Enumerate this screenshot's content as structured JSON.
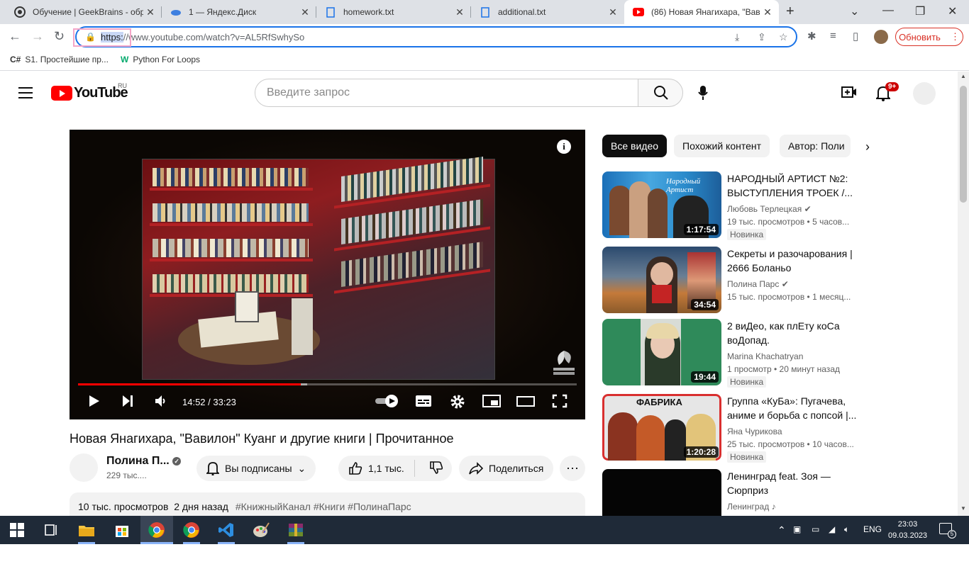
{
  "browser": {
    "tabs": [
      {
        "title": "Обучение | GeekBrains - обр",
        "icon": "geekbrains-icon"
      },
      {
        "title": "1 — Яндекс.Диск",
        "icon": "yandex-disk-icon"
      },
      {
        "title": "homework.txt",
        "icon": "document-icon"
      },
      {
        "title": "additional.txt",
        "icon": "document-icon"
      },
      {
        "title": "(86) Новая Янагихара, \"Вави",
        "icon": "youtube-icon"
      }
    ],
    "url_scheme": "https:",
    "url_rest": "//www.youtube.com/watch?v=AL5RfSwhySo",
    "update_label": "Обновить",
    "bookmarks": [
      "S1. Простейшие пр...",
      "Python For Loops"
    ]
  },
  "youtube": {
    "logo_text": "YouTube",
    "region": "RU",
    "search_placeholder": "Введите запрос",
    "notif_badge": "9+",
    "player": {
      "time": "14:52 / 33:23",
      "progress": 0.446
    },
    "video_title": "Новая Янагихара, \"Вавилон\" Куанг и другие книги | Прочитанное",
    "channel_name": "Полина П...",
    "subscribers": "229 тыс....",
    "subscribed_label": "Вы подписаны",
    "likes": "1,1 тыс.",
    "share_label": "Поделиться",
    "views": "10 тыс. просмотров",
    "date": "2 дня назад",
    "tags": "#КнижныйКанал #Книги #ПолинаПарс",
    "chips": [
      "Все видео",
      "Похожий контент",
      "Автор: Поли"
    ],
    "recommendations": [
      {
        "title": "НАРОДНЫЙ АРТИСТ №2: ВЫСТУПЛЕНИЯ ТРОЕК /...",
        "channel": "Любовь Терлецкая",
        "meta": "19 тыс. просмотров • 5 часов...",
        "duration": "1:17:54",
        "badge": "Новинка"
      },
      {
        "title": "Секреты и разочарования | 2666 Боланьо",
        "channel": "Полина Парс",
        "meta": "15 тыс. просмотров • 1 месяц...",
        "duration": "34:54",
        "badge": ""
      },
      {
        "title": "2 виДео, как плЕту коСа воДопад.",
        "channel": "Marina Khachatryan",
        "meta": "1 просмотр • 20 минут назад",
        "duration": "19:44",
        "badge": "Новинка"
      },
      {
        "title": "Группа «КуБа»: Пугачева, аниме и борьба с попсой |...",
        "channel": "Яна Чурикова",
        "meta": "25 тыс. просмотров • 10 часов...",
        "duration": "1:20:28",
        "badge": "Новинка",
        "thumb_text": "ФАБРИКА"
      },
      {
        "title": "Ленинград feat. Зоя — Сюрприз",
        "channel": "Ленинград ♪",
        "meta": "",
        "duration": "",
        "badge": ""
      }
    ]
  },
  "taskbar": {
    "lang": "ENG",
    "time": "23:03",
    "date": "09.03.2023",
    "notifications": "5"
  }
}
